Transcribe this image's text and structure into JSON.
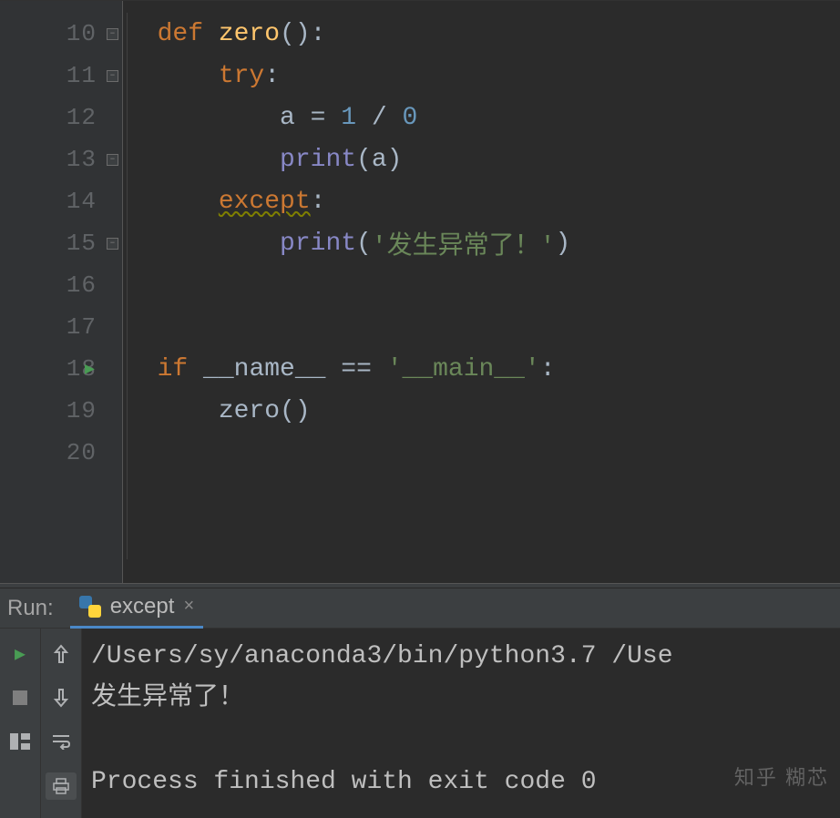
{
  "gutter": {
    "lines": [
      "10",
      "11",
      "12",
      "13",
      "14",
      "15",
      "16",
      "17",
      "18",
      "19",
      "20"
    ]
  },
  "code": {
    "l10": {
      "def": "def ",
      "fn": "zero",
      "rest": "():"
    },
    "l11": {
      "try": "try",
      "colon": ":"
    },
    "l12": {
      "a": "a ",
      "eq": "= ",
      "one": "1",
      "slash": " / ",
      "zero": "0"
    },
    "l13": {
      "print": "print",
      "op": "(a)"
    },
    "l14": {
      "except": "except",
      "colon": ":"
    },
    "l15": {
      "print": "print",
      "op1": "(",
      "str": "'发生异常了！'",
      "op2": ")"
    },
    "l18": {
      "if": "if ",
      "name": "__name__ ",
      "eq": "== ",
      "main": "'__main__'",
      "colon": ":"
    },
    "l19": {
      "call": "zero()"
    }
  },
  "run": {
    "label": "Run:",
    "tab_title": "except",
    "output_line1": "/Users/sy/anaconda3/bin/python3.7 /Use",
    "output_line2": "发生异常了！",
    "output_line3": "",
    "output_line4": "Process finished with exit code 0"
  },
  "watermark": "知乎 糊芯"
}
